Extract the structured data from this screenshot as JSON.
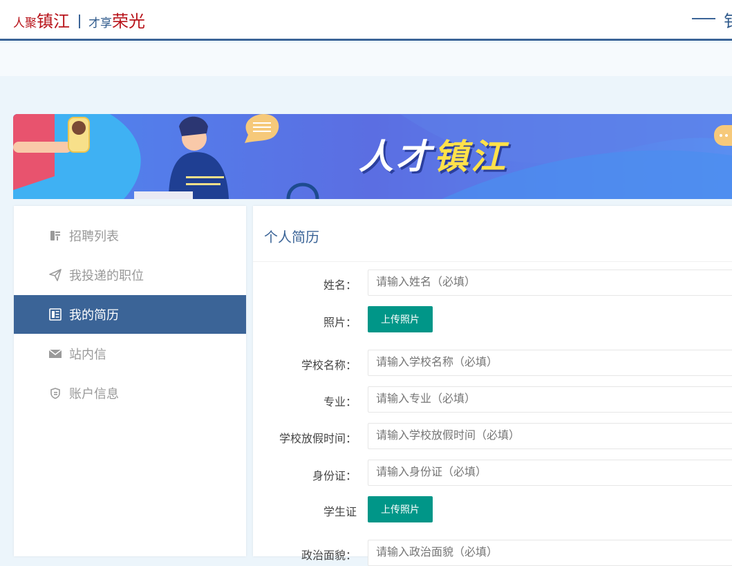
{
  "header": {
    "logo": {
      "part1_small": "人聚",
      "part1_large": "镇江",
      "part2_small": "才享",
      "part2_large": "荣光"
    },
    "cut_text": "钅"
  },
  "banner": {
    "title_white": "人才",
    "title_yellow": "镇江"
  },
  "sidebar": {
    "items": [
      {
        "label": "招聘列表",
        "icon": "recruit-icon"
      },
      {
        "label": "我投递的职位",
        "icon": "paper-plane-icon"
      },
      {
        "label": "我的简历",
        "icon": "resume-icon",
        "active": true
      },
      {
        "label": "站内信",
        "icon": "envelope-icon"
      },
      {
        "label": "账户信息",
        "icon": "shield-icon"
      }
    ]
  },
  "main": {
    "title": "个人简历",
    "upload_label": "上传照片",
    "fields": {
      "name": {
        "label": "姓名：",
        "placeholder": "请输入姓名（必填）"
      },
      "photo": {
        "label": "照片："
      },
      "school": {
        "label": "学校名称：",
        "placeholder": "请输入学校名称（必填）"
      },
      "major": {
        "label": "专业：",
        "placeholder": "请输入专业（必填）"
      },
      "vacation": {
        "label": "学校放假时间：",
        "placeholder": "请输入学校放假时间（必填）"
      },
      "id_card": {
        "label": "身份证：",
        "placeholder": "请输入身份证（必填）"
      },
      "student_card": {
        "label": "学生证"
      },
      "politics": {
        "label": "政治面貌：",
        "placeholder": "请输入政治面貌（必填）"
      }
    }
  },
  "colors": {
    "primary": "#3b6497",
    "brand_red": "#b8141b",
    "upload_green": "#009688",
    "page_bg": "#ecf5fb"
  }
}
